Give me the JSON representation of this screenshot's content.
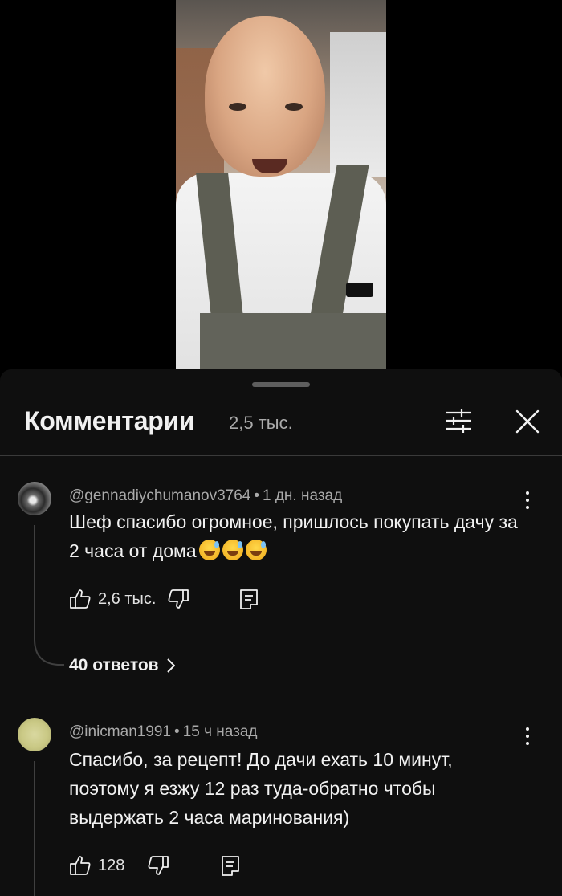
{
  "comments_panel": {
    "title": "Комментарии",
    "count": "2,5 тыс."
  },
  "comments": [
    {
      "author": "@gennadiychumanov3764",
      "time": "1 дн. назад",
      "text": "Шеф спасибо огромное, пришлось покупать дачу за 2 часа от дома",
      "emoji": [
        "grinning-sweat-emoji",
        "grinning-sweat-emoji",
        "grinning-sweat-emoji"
      ],
      "likes": "2,6 тыс.",
      "replies": "40 ответов"
    },
    {
      "author": "@inicman1991",
      "time": "15 ч назад",
      "text": "Спасибо, за рецепт! До дачи ехать 10 минут, поэтому я езжу 12 раз туда-обратно чтобы выдержать 2 часа маринования)",
      "likes": "128"
    }
  ],
  "separator": "•",
  "icons": {
    "filter": "sliders-icon",
    "close": "close-icon",
    "like": "thumb-up-icon",
    "dislike": "thumb-down-icon",
    "reply": "reply-icon",
    "more": "more-vertical-icon",
    "chevron": "chevron-right-icon"
  },
  "colors": {
    "background": "#0f0f0f",
    "text": "#f1f1f1",
    "secondary_text": "#aaaaaa",
    "divider": "#3a3a3a"
  }
}
